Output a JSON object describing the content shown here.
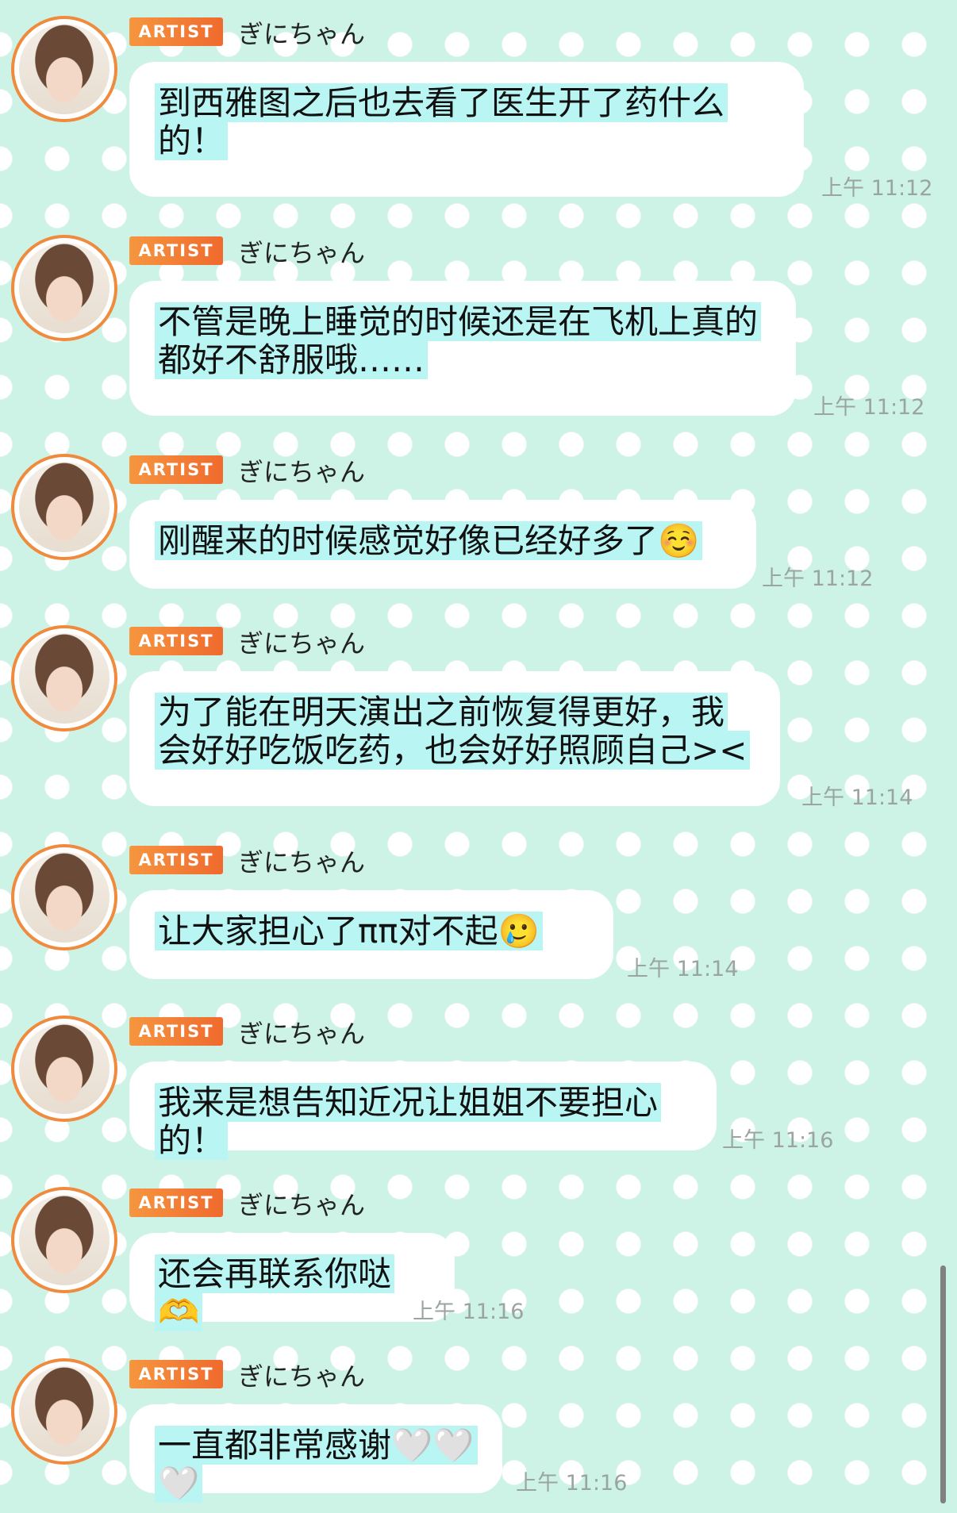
{
  "badge_label": "ARTIST",
  "sender_name": "ぎにちゃん",
  "messages": [
    {
      "text": "到西雅图之后也去看了医生开了药什么的！",
      "time": "上午 11:12"
    },
    {
      "text": "不管是晚上睡觉的时候还是在飞机上真的都好不舒服哦……",
      "time": "上午 11:12"
    },
    {
      "text": "刚醒来的时候感觉好像已经好多了☺️",
      "time": "上午 11:12"
    },
    {
      "text": "为了能在明天演出之前恢复得更好，我会好好吃饭吃药，也会好好照顾自己><",
      "time": "上午 11:14"
    },
    {
      "text": "让大家担心了ππ对不起🥲",
      "time": "上午 11:14"
    },
    {
      "text": "我来是想告知近况让姐姐不要担心的！",
      "time": "上午 11:16"
    },
    {
      "text": "还会再联系你哒🫶",
      "time": "上午 11:16"
    },
    {
      "text": "一直都非常感谢🤍🤍🤍",
      "time": "上午 11:16"
    }
  ],
  "colors": {
    "background": "#cdf3e6",
    "polka_dot": "#ffffff",
    "bubble": "#ffffff",
    "text_highlight": "#b8f5f3",
    "badge": "#f08a3c",
    "timestamp": "#9aa4a0"
  }
}
